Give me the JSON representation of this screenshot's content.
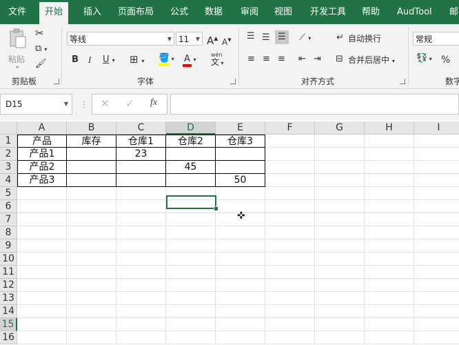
{
  "ribbon_tabs": [
    "文件",
    "开始",
    "插入",
    "页面布局",
    "公式",
    "数据",
    "审阅",
    "视图",
    "开发工具",
    "帮助",
    "AudTool",
    "邮"
  ],
  "active_tab": "开始",
  "clipboard": {
    "paste_label": "粘贴",
    "group_label": "剪贴板"
  },
  "font": {
    "name": "等线",
    "size": "11",
    "grow": "A",
    "shrink": "A",
    "bold": "B",
    "italic": "I",
    "underline": "U",
    "font_color": "A",
    "fill_label": "wén",
    "fill_char": "文",
    "group_label": "字体"
  },
  "alignment": {
    "wrap_label": "自动换行",
    "merge_label": "合并后居中",
    "group_label": "对齐方式"
  },
  "number": {
    "format": "常规",
    "percent": "%",
    "group_label": "数字"
  },
  "name_box": "D15",
  "formula_bar": {
    "fx_label": "fx",
    "value": ""
  },
  "columns": [
    "A",
    "B",
    "C",
    "D",
    "E",
    "F",
    "G",
    "H",
    "I"
  ],
  "rows": [
    "1",
    "2",
    "3",
    "4",
    "5",
    "6",
    "7",
    "8",
    "9",
    "10",
    "11",
    "12",
    "13",
    "14",
    "15",
    "16"
  ],
  "selected_column": "D",
  "selected_row": "15",
  "cells": {
    "A1": "产品",
    "B1": "库存",
    "C1": "仓库1",
    "D1": "仓库2",
    "E1": "仓库3",
    "A2": "产品1",
    "C2": "23",
    "A3": "产品2",
    "D3": "45",
    "A4": "产品3",
    "E4": "50"
  }
}
